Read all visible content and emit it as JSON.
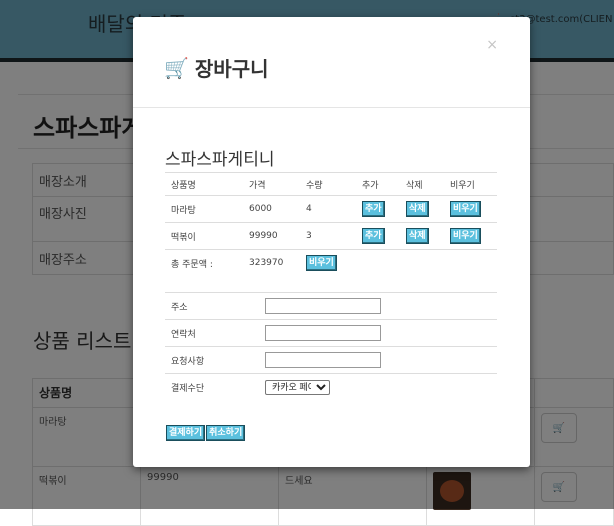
{
  "background": {
    "brand": "배달의 민족",
    "user_email": "st3@test.com(CLIEN",
    "store_title": "스파스파게",
    "info_rows": [
      "매장소개",
      "매장사진",
      "매장주소"
    ],
    "products_title": "상품 리스트",
    "products_header": {
      "name": "상품명"
    },
    "products": [
      {
        "name": "마라탕",
        "price": "",
        "desc": ""
      },
      {
        "name": "떡볶이",
        "price": "99990",
        "desc": "드세요"
      }
    ]
  },
  "modal": {
    "title": "장바구니",
    "close_label": "×",
    "store_name": "스파스파게티니",
    "columns": [
      "상품명",
      "가격",
      "수량",
      "추가",
      "삭제",
      "비우기"
    ],
    "items": [
      {
        "name": "마라탕",
        "price": "6000",
        "qty": "4",
        "add": "추가",
        "delete": "삭제",
        "clear": "비우기"
      },
      {
        "name": "떡볶이",
        "price": "99990",
        "qty": "3",
        "add": "추가",
        "delete": "삭제",
        "clear": "비우기"
      }
    ],
    "total": {
      "label": "총 주문액 :",
      "value": "323970",
      "clear": "비우기"
    },
    "form": {
      "address_label": "주소",
      "address_value": "",
      "contact_label": "연락처",
      "contact_value": "",
      "request_label": "요청사항",
      "request_value": "",
      "payment_label": "결제수단",
      "payment_selected": "카카오 페이"
    },
    "pay_button": "결제하기",
    "cancel_button": "취소하기"
  }
}
